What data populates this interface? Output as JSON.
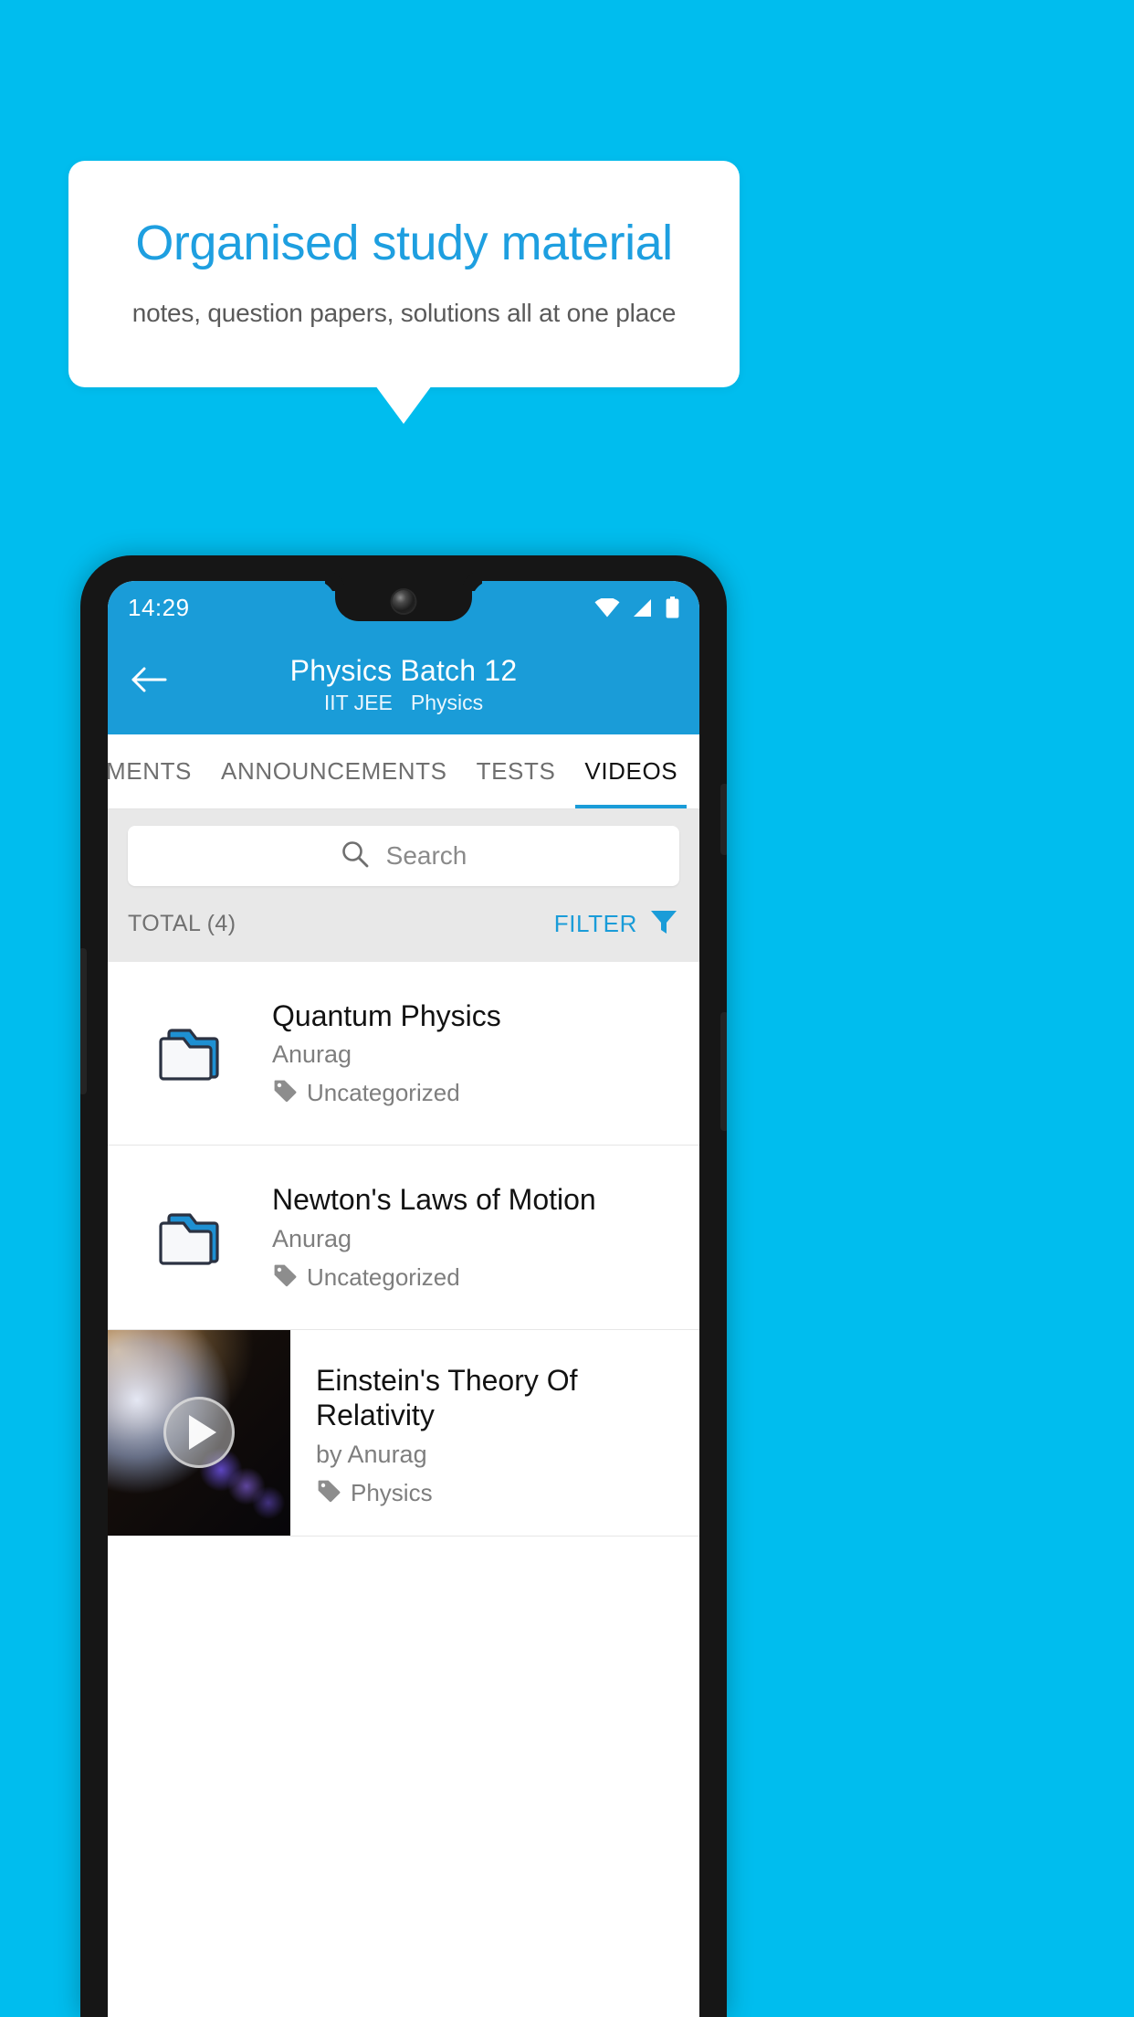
{
  "promo": {
    "title": "Organised study material",
    "subtitle": "notes, question papers, solutions all at one place",
    "accent_color": "#1E9FE0",
    "background_color": "#00BDEE"
  },
  "phone": {
    "status_bar": {
      "time": "14:29",
      "icons": [
        "wifi-icon",
        "signal-icon",
        "battery-icon"
      ]
    },
    "app_bar": {
      "back_icon": "back-arrow-icon",
      "title": "Physics Batch 12",
      "subtitle_course": "IIT JEE",
      "subtitle_subject": "Physics",
      "color": "#1A9CD8"
    },
    "tabs": [
      {
        "label": "MENTS",
        "active": false
      },
      {
        "label": "ANNOUNCEMENTS",
        "active": false
      },
      {
        "label": "TESTS",
        "active": false
      },
      {
        "label": "VIDEOS",
        "active": true
      }
    ],
    "search": {
      "icon": "search-icon",
      "placeholder": "Search",
      "value": ""
    },
    "toolbar": {
      "total_label": "TOTAL (4)",
      "filter_label": "FILTER",
      "filter_icon": "filter-funnel-icon"
    },
    "list": [
      {
        "type": "folder",
        "icon": "folder-icon",
        "title": "Quantum Physics",
        "author": "Anurag",
        "tag_icon": "tag-icon",
        "tag": "Uncategorized"
      },
      {
        "type": "folder",
        "icon": "folder-icon",
        "title": "Newton's Laws of Motion",
        "author": "Anurag",
        "tag_icon": "tag-icon",
        "tag": "Uncategorized"
      },
      {
        "type": "video",
        "icon": "play-icon",
        "title": "Einstein's Theory Of Relativity",
        "author": "by Anurag",
        "tag_icon": "tag-icon",
        "tag": "Physics"
      }
    ]
  }
}
